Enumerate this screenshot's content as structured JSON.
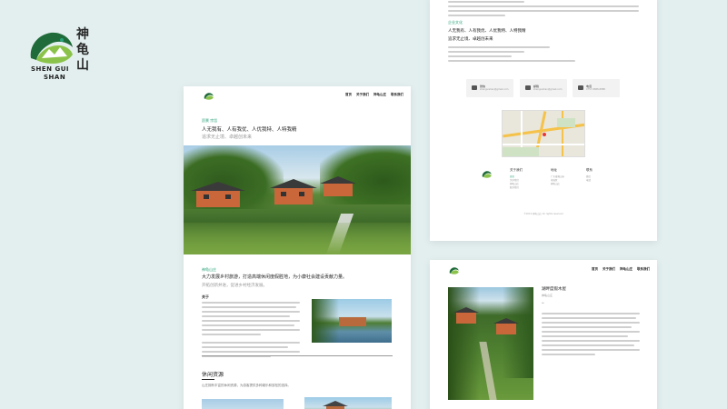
{
  "brand": {
    "logo_text_line1": "SHEN GUI",
    "logo_text_line2": "SHAN",
    "logo_chinese": "神龟山",
    "color_green": "#2aa37a",
    "color_dark_green": "#1f6b3a",
    "color_accent": "#8bc34a"
  },
  "page1": {
    "nav": [
      "首页",
      "关于我们",
      "神龟山庄",
      "联系我们"
    ],
    "eyebrow": "愿景 宗旨",
    "headline": "人无我有、人有我优、人优我特、人特我精",
    "subline": "追求无止境、卓越创未来",
    "section2_eyebrow": "神龟山庄",
    "section2_headline": "大力发展乡村旅游，打造高端休闲度假胜地，为小康社会建设贡献力量。",
    "section2_subline": "开拓创新并进，促进乡村经济发展。",
    "about_label": "关于",
    "leisure_title": "休闲资源",
    "leisure_desc": "山庄拥有丰富的休闲资源，为游客提供多种娱乐和放松的选择。"
  },
  "page2": {
    "eyebrow": "企业文化",
    "headline_lines": [
      "人无我有、人有我优、人优我特、人特我精",
      "追求无止境、卓越创未来"
    ],
    "contact_cards": [
      {
        "icon": "chat-icon",
        "label": "微信",
        "value": "shenguishan@gmail.com"
      },
      {
        "icon": "mail-icon",
        "label": "邮箱",
        "value": "shenguishan@gmail.com"
      },
      {
        "icon": "phone-icon",
        "label": "电话",
        "value": "0757-8888-8888"
      }
    ],
    "footer_cols": [
      {
        "title": "关于我们",
        "items": [
          "首页",
          "关于我们",
          "神龟山庄",
          "联系我们"
        ]
      },
      {
        "title": "地址",
        "items": [
          "广东省佛山市",
          "南海区",
          "神龟山庄"
        ]
      },
      {
        "title": "联系",
        "items": [
          "微信",
          "电话"
        ]
      }
    ],
    "copyright": "©2019 神龟山庄 All rights reserved"
  },
  "page3": {
    "nav": [
      "首页",
      "关于我们",
      "神龟山庄",
      "联系我们"
    ],
    "title": "湖畔度假木屋",
    "subtitle": "神龟山庄"
  }
}
